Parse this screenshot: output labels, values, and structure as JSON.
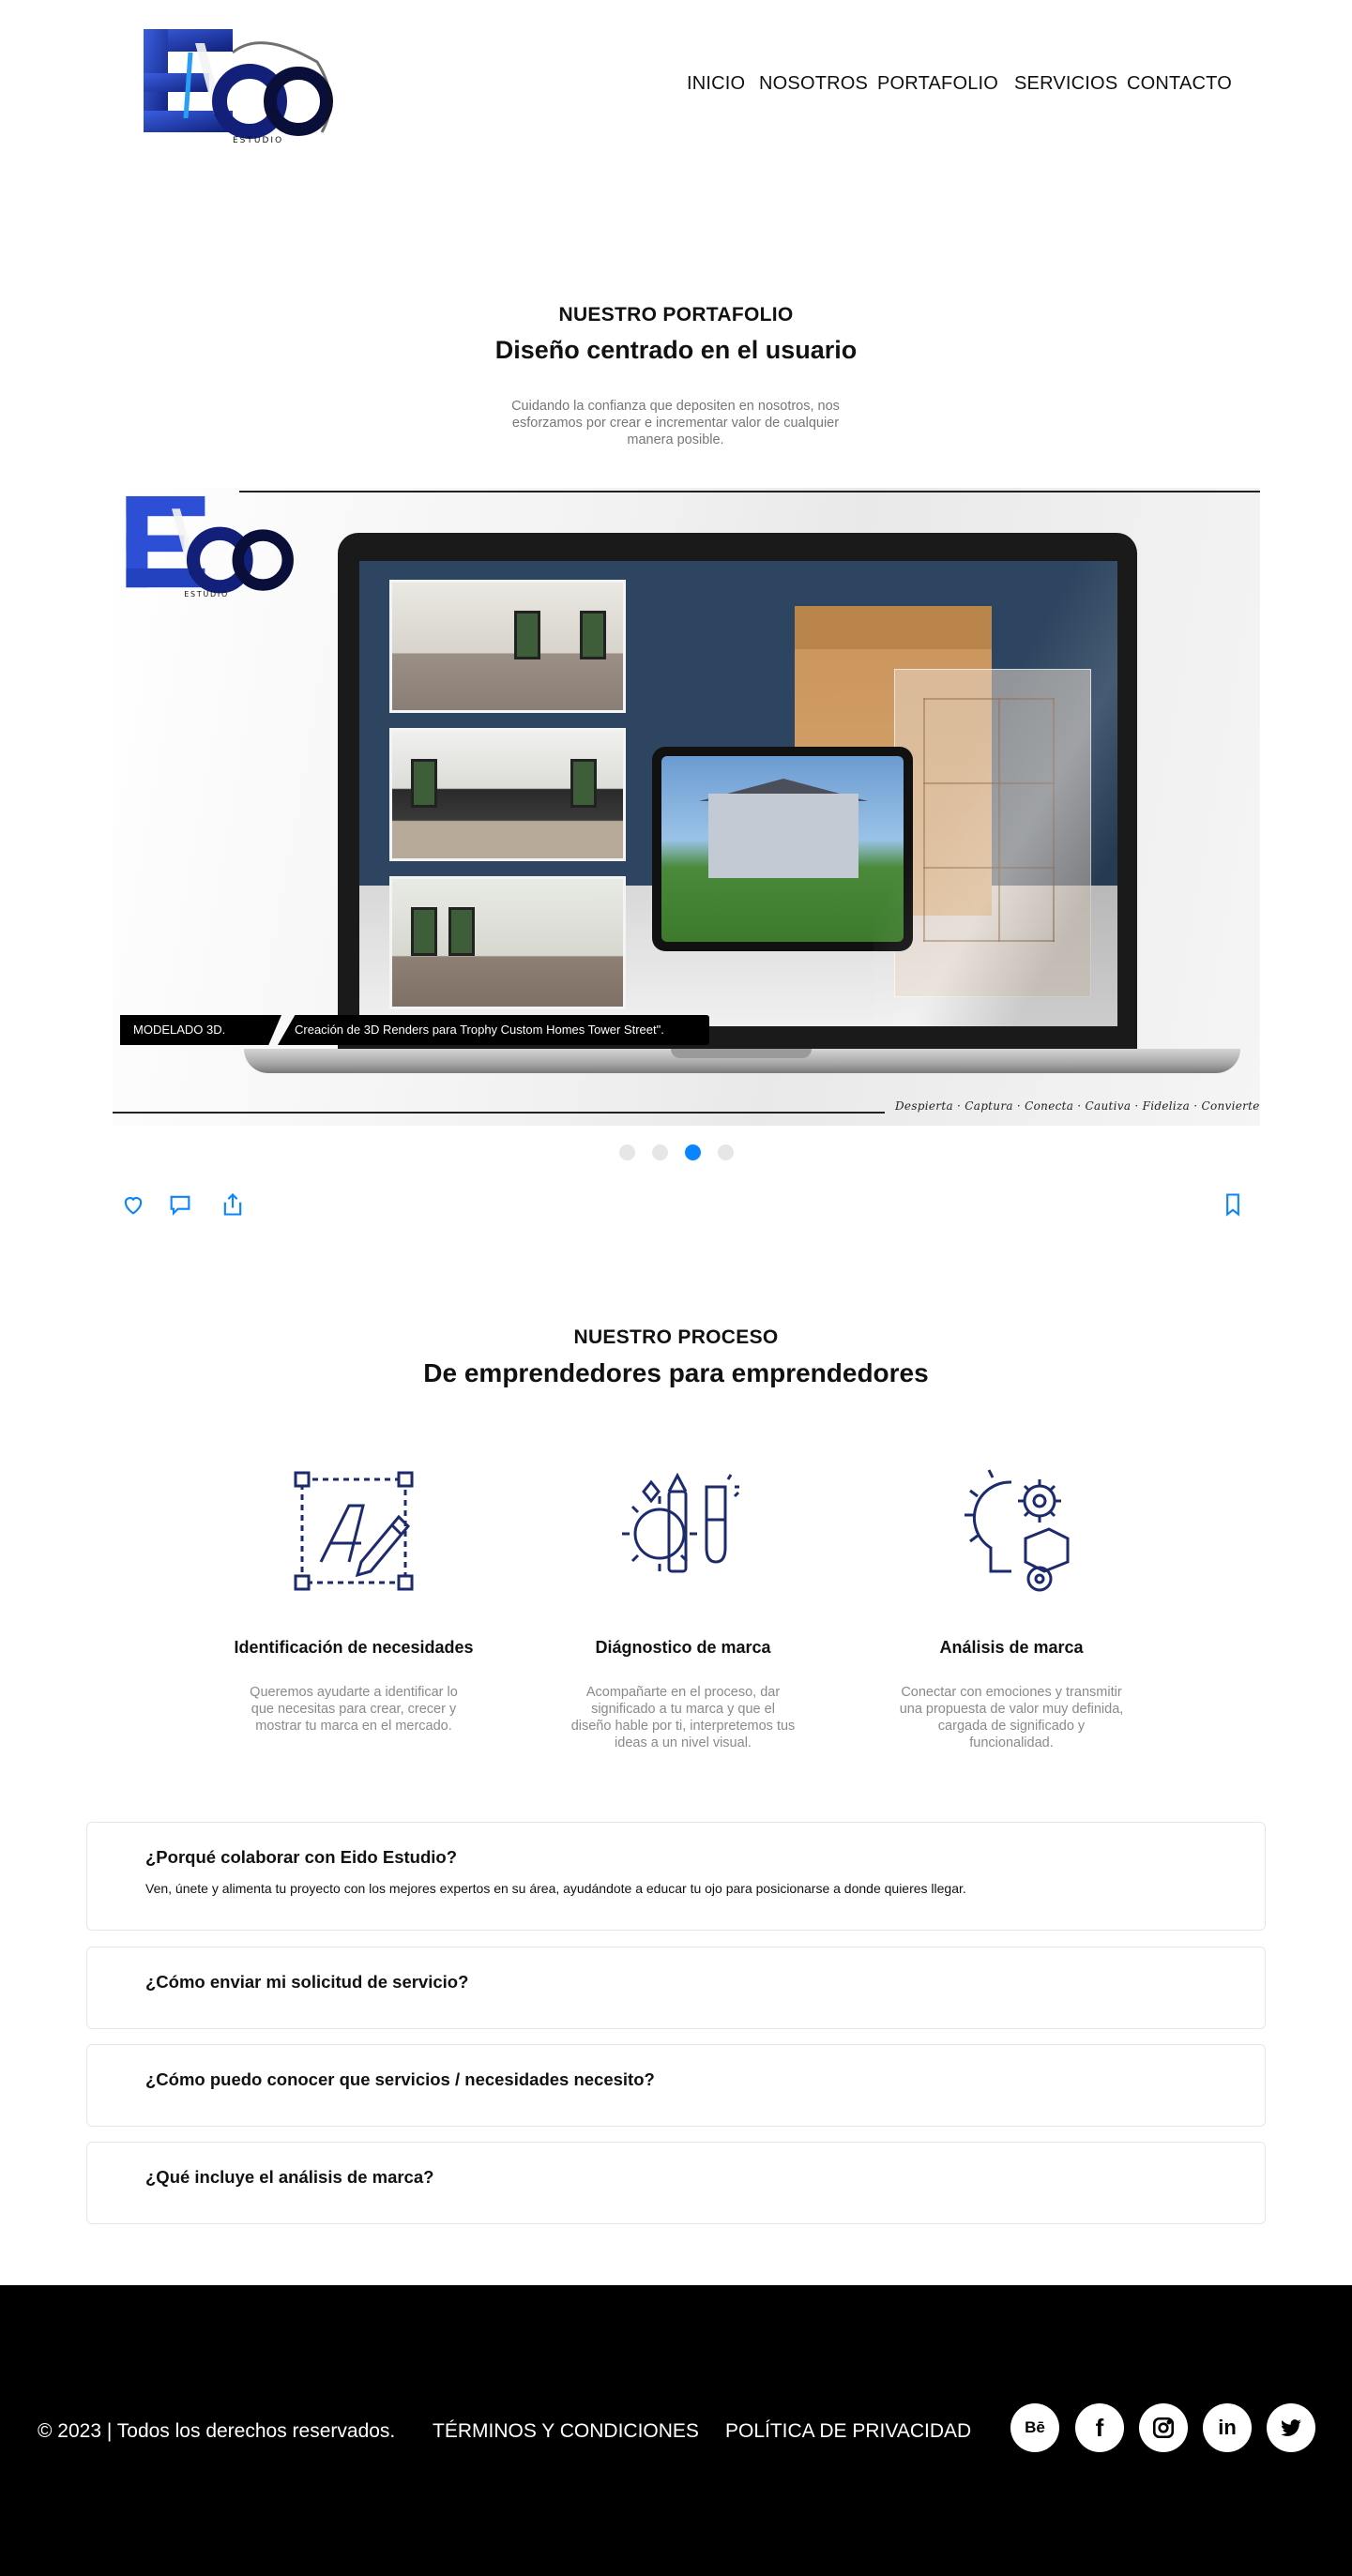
{
  "header": {
    "logo_text": "EIDO",
    "logo_subtext": "ESTUDIO",
    "nav": [
      {
        "label": "INICIO"
      },
      {
        "label": "NOSOTROS"
      },
      {
        "label": "PORTAFOLIO"
      },
      {
        "label": "SERVICIOS"
      },
      {
        "label": "CONTACTO"
      }
    ]
  },
  "portfolio": {
    "kicker": "NUESTRO PORTAFOLIO",
    "title": "Diseño centrado en el usuario",
    "subtitle": "Cuidando la confianza que depositen en nosotros, nos esforzamos por crear e incrementar valor de cualquier manera posible.",
    "slide": {
      "category": "MODELADO 3D.",
      "caption": "Creación de 3D Renders para Trophy Custom Homes Tower Street\".",
      "tagline": "Despierta · Captura · Conecta · Cautiva · Fideliza · Convierte · Triunfa"
    },
    "carousel": {
      "total_slides": 4,
      "active_slide": 3
    },
    "actions": [
      {
        "icon": "heart-icon"
      },
      {
        "icon": "comment-icon"
      },
      {
        "icon": "share-icon"
      },
      {
        "icon": "bookmark-icon"
      }
    ]
  },
  "process": {
    "kicker": "NUESTRO PROCESO",
    "title": "De emprendedores para emprendedores",
    "items": [
      {
        "name": "Identificación de necesidades",
        "desc": "Queremos ayudarte a identificar lo que necesitas para crear, crecer y mostrar tu marca en el mercado.",
        "icon": "design-pen-icon"
      },
      {
        "name": "Diágnostico de marca",
        "desc": "Acompañarte en el proceso, dar significado a tu marca y que el diseño hable por ti, interpretemos tus ideas a un nivel visual.",
        "icon": "gear-pencil-brush-icon"
      },
      {
        "name": "Análisis de marca",
        "desc": "Conectar con emociones y transmitir una propuesta de valor muy definida, cargada de significado y funcionalidad.",
        "icon": "lightbulb-gears-icon"
      }
    ]
  },
  "faq": [
    {
      "question": "¿Porqué colaborar con Eido Estudio?",
      "answer": "Ven, únete y alimenta tu proyecto con los mejores expertos en su área, ayudándote a educar tu ojo para posicionarse a donde quieres llegar."
    },
    {
      "question": "¿Cómo enviar mi solicitud de servicio?",
      "answer": ""
    },
    {
      "question": "¿Cómo puedo conocer que servicios / necesidades necesito?",
      "answer": ""
    },
    {
      "question": "¿Qué incluye el análisis de marca?",
      "answer": ""
    }
  ],
  "footer": {
    "copyright": "© 2023 | Todos los derechos reservados.",
    "terms": "TÉRMINOS Y CONDICIONES",
    "privacy": "POLÍTICA DE PRIVACIDAD",
    "social": [
      {
        "name": "behance-icon",
        "label": "Bē"
      },
      {
        "name": "facebook-icon",
        "label": "f"
      },
      {
        "name": "instagram-icon",
        "label": ""
      },
      {
        "name": "linkedin-icon",
        "label": "in"
      },
      {
        "name": "twitter-icon",
        "label": ""
      }
    ]
  },
  "colors": {
    "brand_blue": "#1f3fb8",
    "accent_blue": "#0a84ff",
    "footer_bg": "#000000",
    "muted_text": "#8a8a8a"
  }
}
